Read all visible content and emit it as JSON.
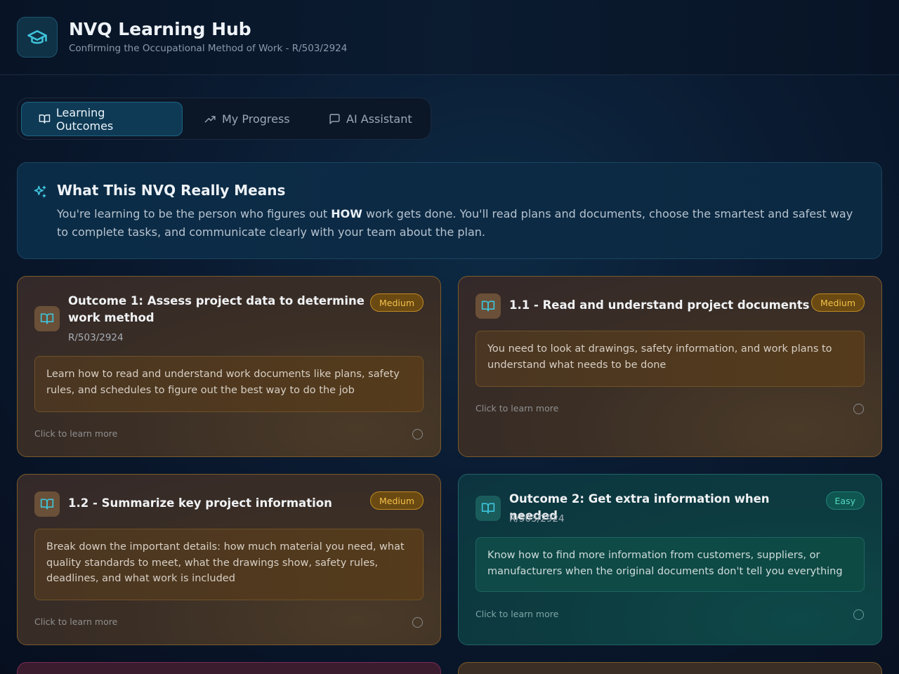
{
  "header": {
    "title": "NVQ Learning Hub",
    "subtitle": "Confirming the Occupational Method of Work - R/503/2924"
  },
  "tabs": [
    {
      "label": "Learning Outcomes",
      "icon": "book-open-icon",
      "active": true
    },
    {
      "label": "My Progress",
      "icon": "trending-up-icon",
      "active": false
    },
    {
      "label": "AI Assistant",
      "icon": "message-square-icon",
      "active": false
    }
  ],
  "intro": {
    "title": "What This NVQ Really Means",
    "text_before": "You're learning to be the person who figures out ",
    "text_bold": "HOW",
    "text_after": " work gets done. You'll read plans and documents, choose the smartest and safest way to complete tasks, and communicate clearly with your team about the plan."
  },
  "cards": [
    {
      "title": "Outcome 1: Assess project data to determine work method",
      "code": "R/503/2924",
      "badge": "Medium",
      "description": "Learn how to read and understand work documents like plans, safety rules, and schedules to figure out the best way to do the job",
      "cta": "Click to learn more"
    },
    {
      "title": "1.1 - Read and understand project documents",
      "badge": "Medium",
      "description": "You need to look at drawings, safety information, and work plans to understand what needs to be done",
      "cta": "Click to learn more"
    },
    {
      "title": "1.2 - Summarize key project information",
      "badge": "Medium",
      "description": "Break down the important details: how much material you need, what quality standards to meet, what the drawings show, safety rules, deadlines, and what work is included",
      "cta": "Click to learn more"
    },
    {
      "title": "Outcome 2: Get extra information when needed",
      "code": "R/503/2924",
      "badge": "Easy",
      "description": "Know how to find more information from customers, suppliers, or manufacturers when the original documents don't tell you everything",
      "cta": "Click to learn more"
    }
  ],
  "colors": {
    "accent": "#3fc4dc",
    "medium": "#f5c04a",
    "easy": "#55d8c4"
  }
}
